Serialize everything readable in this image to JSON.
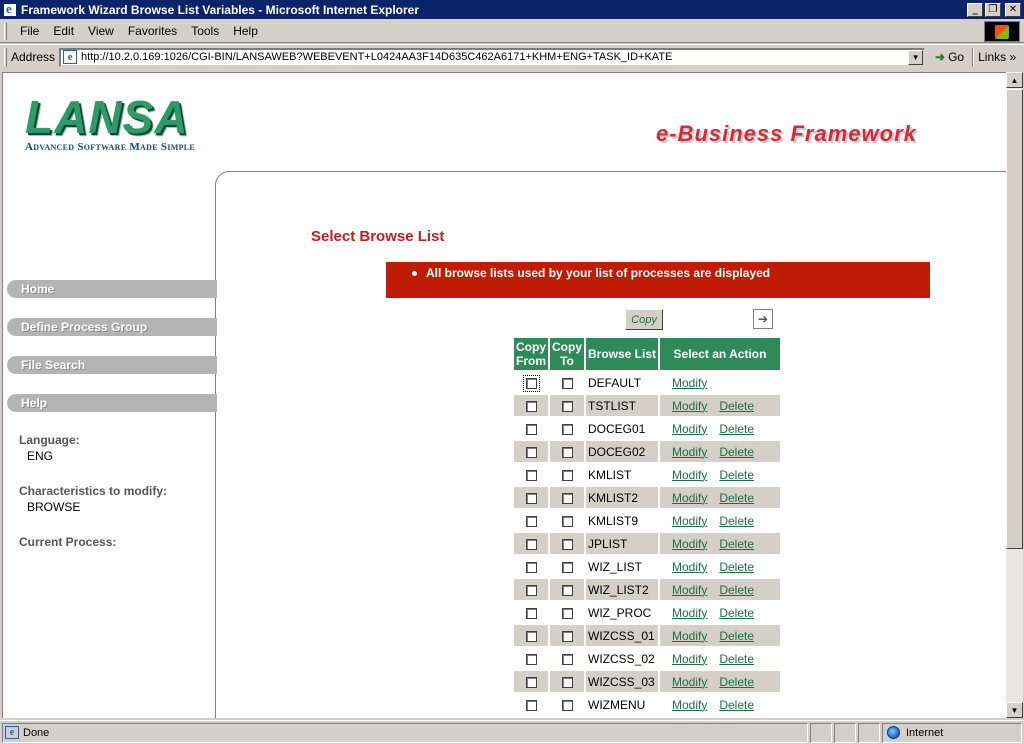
{
  "window": {
    "title": "Framework Wizard Browse List Variables - Microsoft Internet Explorer"
  },
  "menu": {
    "items": [
      "File",
      "Edit",
      "View",
      "Favorites",
      "Tools",
      "Help"
    ]
  },
  "address": {
    "label": "Address",
    "url": "http://10.2.0.169:1026/CGI-BIN/LANSAWEB?WEBEVENT+L0424AA3F14D635C462A6171+KHM+ENG+TASK_ID+KATE",
    "go_label": "Go",
    "links_label": "Links"
  },
  "header": {
    "logo_text": "LANSA",
    "logo_tagline": "Advanced Software Made Simple",
    "product_tagline": "e-Business Framework"
  },
  "nav": {
    "items": [
      "Home",
      "Define Process Group",
      "File Search",
      "Help"
    ]
  },
  "info": {
    "language_label": "Language:",
    "language_value": "ENG",
    "characteristics_label": "Characteristics to modify:",
    "characteristics_value": "BROWSE",
    "current_process_label": "Current Process:"
  },
  "main": {
    "title": "Select Browse List",
    "message": "All browse lists used by your list of processes are displayed",
    "copy_button": "Copy",
    "columns": {
      "copy_from": "Copy From",
      "copy_to": "Copy To",
      "browse_list": "Browse List",
      "action": "Select an Action"
    },
    "modify_label": "Modify",
    "delete_label": "Delete",
    "rows": [
      {
        "name": "DEFAULT",
        "delete": false
      },
      {
        "name": "TSTLIST",
        "delete": true
      },
      {
        "name": "DOCEG01",
        "delete": true
      },
      {
        "name": "DOCEG02",
        "delete": true
      },
      {
        "name": "KMLIST",
        "delete": true
      },
      {
        "name": "KMLIST2",
        "delete": true
      },
      {
        "name": "KMLIST9",
        "delete": true
      },
      {
        "name": "JPLIST",
        "delete": true
      },
      {
        "name": "WIZ_LIST",
        "delete": true
      },
      {
        "name": "WIZ_LIST2",
        "delete": true
      },
      {
        "name": "WIZ_PROC",
        "delete": true
      },
      {
        "name": "WIZCSS_01",
        "delete": true
      },
      {
        "name": "WIZCSS_02",
        "delete": true
      },
      {
        "name": "WIZCSS_03",
        "delete": true
      },
      {
        "name": "WIZMENU",
        "delete": true
      }
    ]
  },
  "status": {
    "text": "Done",
    "zone": "Internet"
  },
  "colors": {
    "title_bar": "#0a246a",
    "header_green": "#2f8a5a",
    "message_red": "#c01c05",
    "title_red": "#c41e1e",
    "link_green": "#1e6e42"
  }
}
